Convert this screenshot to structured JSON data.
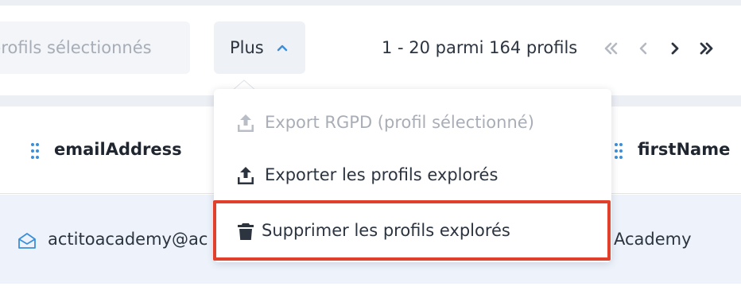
{
  "toolbar": {
    "selected_profiles_label": "profils sélectionnés",
    "more_label": "Plus",
    "pagination_text": "1 - 20 parmi 164 profils"
  },
  "menu": {
    "items": [
      {
        "label": "Export RGPD (profil sélectionné)",
        "icon": "upload-icon",
        "disabled": true
      },
      {
        "label": "Exporter les profils explorés",
        "icon": "upload-icon",
        "disabled": false
      },
      {
        "label": "Supprimer les profils explorés",
        "icon": "trash-icon",
        "disabled": false,
        "highlighted": true
      }
    ]
  },
  "table": {
    "columns": [
      "emailAddress",
      "firstName"
    ],
    "rows": [
      {
        "emailAddress": "actitoacademy@ac",
        "firstName": "Academy"
      }
    ]
  },
  "colors": {
    "accent": "#3b8fd9",
    "highlight_border": "#e0402c",
    "row_background": "#eef3fb"
  }
}
